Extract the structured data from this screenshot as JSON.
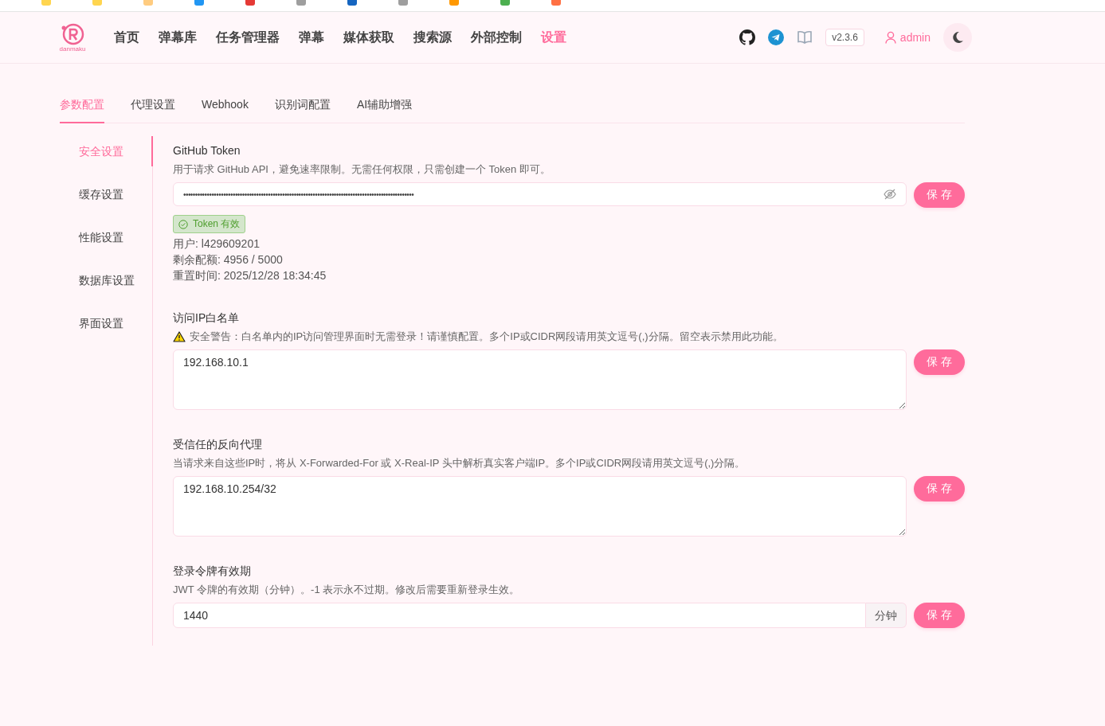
{
  "logo": {
    "text": "danmaku"
  },
  "nav": [
    {
      "label": "首页",
      "selected": false
    },
    {
      "label": "弹幕库",
      "selected": false
    },
    {
      "label": "任务管理器",
      "selected": false
    },
    {
      "label": "弹幕",
      "selected": false
    },
    {
      "label": "媒体获取",
      "selected": false
    },
    {
      "label": "搜索源",
      "selected": false
    },
    {
      "label": "外部控制",
      "selected": false
    },
    {
      "label": "设置",
      "selected": true
    }
  ],
  "header": {
    "version": "v2.3.6",
    "user": "admin"
  },
  "tabs": [
    {
      "label": "参数配置",
      "selected": true
    },
    {
      "label": "代理设置",
      "selected": false
    },
    {
      "label": "Webhook",
      "selected": false
    },
    {
      "label": "识别词配置",
      "selected": false
    },
    {
      "label": "AI辅助增强",
      "selected": false
    }
  ],
  "sidebar": [
    {
      "label": "安全设置",
      "selected": true
    },
    {
      "label": "缓存设置",
      "selected": false
    },
    {
      "label": "性能设置",
      "selected": false
    },
    {
      "label": "数据库设置",
      "selected": false
    },
    {
      "label": "界面设置",
      "selected": false
    }
  ],
  "sections": [
    {
      "kind": "password",
      "title": "GitHub Token",
      "description": "用于请求 GitHub API，避免速率限制。无需任何权限，只需创建一个 Token 即可。",
      "value": "••••••••••••••••••••••••••••••••••••••••••••••••••••••••••••••••••••••••••••••••••••••••••••••••••",
      "button": "保 存",
      "status": "Token 有效",
      "info": [
        "用户: l429609201",
        "剩余配额: 4956 / 5000",
        "重置时间: 2025/12/28 18:34:45"
      ]
    },
    {
      "kind": "textarea",
      "title": "访问IP白名单",
      "description": "安全警告：白名单内的IP访问管理界面时无需登录！请谨慎配置。多个IP或CIDR网段请用英文逗号(,)分隔。留空表示禁用此功能。",
      "warning": true,
      "value": "192.168.10.1",
      "button": "保 存"
    },
    {
      "kind": "textarea",
      "title": "受信任的反向代理",
      "description": "当请求来自这些IP时，将从 X-Forwarded-For 或 X-Real-IP 头中解析真实客户端IP。多个IP或CIDR网段请用英文逗号(,)分隔。",
      "warning": false,
      "value": "192.168.10.254/32",
      "button": "保 存"
    },
    {
      "kind": "number",
      "title": "登录令牌有效期",
      "description": "JWT 令牌的有效期（分钟）。-1 表示永不过期。修改后需要重新登录生效。",
      "value": "1440",
      "unit": "分钟",
      "button": "保 存"
    }
  ]
}
